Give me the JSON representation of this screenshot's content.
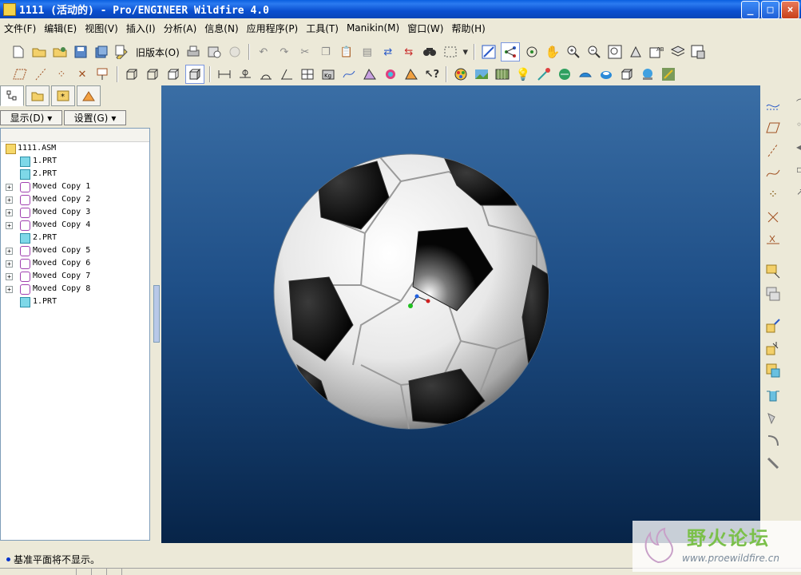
{
  "window": {
    "title": "1111 (活动的) - Pro/ENGINEER Wildfire 4.0",
    "buttons": [
      "_",
      "□",
      "×"
    ]
  },
  "menu": [
    "文件(F)",
    "编辑(E)",
    "视图(V)",
    "插入(I)",
    "分析(A)",
    "信息(N)",
    "应用程序(P)",
    "工具(T)",
    "Manikin(M)",
    "窗口(W)",
    "帮助(H)"
  ],
  "toolbar": {
    "old_version_label": "旧版本(O)"
  },
  "panel": {
    "show_label": "显示(D)",
    "settings_label": "设置(G)"
  },
  "tree": [
    {
      "label": "1111.ASM",
      "type": "asm",
      "expander": false
    },
    {
      "label": "1.PRT",
      "type": "prt",
      "expander": false
    },
    {
      "label": "2.PRT",
      "type": "prt",
      "expander": false
    },
    {
      "label": "Moved Copy 1",
      "type": "moved",
      "expander": true
    },
    {
      "label": "Moved Copy 2",
      "type": "moved",
      "expander": true
    },
    {
      "label": "Moved Copy 3",
      "type": "moved",
      "expander": true
    },
    {
      "label": "Moved Copy 4",
      "type": "moved",
      "expander": true
    },
    {
      "label": "2.PRT",
      "type": "prt",
      "expander": false
    },
    {
      "label": "Moved Copy 5",
      "type": "moved",
      "expander": true
    },
    {
      "label": "Moved Copy 6",
      "type": "moved",
      "expander": true
    },
    {
      "label": "Moved Copy 7",
      "type": "moved",
      "expander": true
    },
    {
      "label": "Moved Copy 8",
      "type": "moved",
      "expander": true
    },
    {
      "label": "1.PRT",
      "type": "prt",
      "expander": false
    }
  ],
  "status": {
    "message": "基准平面将不显示。"
  },
  "watermark": {
    "title": "野火论坛",
    "url": "www.proewildfire.cn"
  }
}
